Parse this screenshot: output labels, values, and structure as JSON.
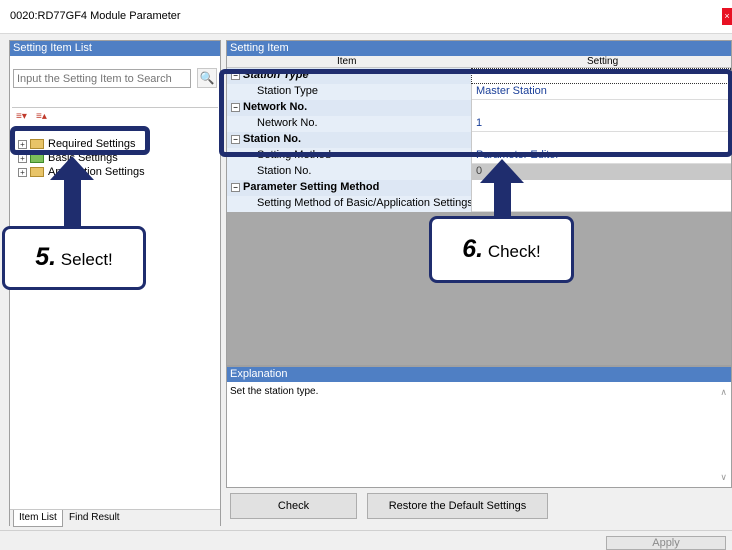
{
  "window": {
    "title": "0020:RD77GF4 Module Parameter",
    "close": "×"
  },
  "left_panel": {
    "header": "Setting Item List",
    "search_placeholder": "Input the Setting Item to Search",
    "tree_items": [
      "Required Settings",
      "Basic Settings",
      "Application Settings"
    ],
    "tabs": [
      "Item List",
      "Find Result"
    ]
  },
  "right_panel": {
    "header": "Setting Item",
    "columns": [
      "Item",
      "Setting"
    ],
    "rows": [
      {
        "item": "Station Type",
        "setting": ""
      },
      {
        "item": "Station Type",
        "setting": "Master Station"
      },
      {
        "item": "Network No.",
        "setting": ""
      },
      {
        "item": "Network No.",
        "setting": "1"
      },
      {
        "item": "Station No.",
        "setting": ""
      },
      {
        "item": "Setting Method",
        "setting": "Parameter Editor"
      },
      {
        "item": "Station No.",
        "setting": "0"
      },
      {
        "item": "Parameter Setting Method",
        "setting": ""
      },
      {
        "item": "Setting Method of Basic/Application Settings",
        "setting": ""
      }
    ]
  },
  "explanation": {
    "header": "Explanation",
    "text": "Set the station type."
  },
  "buttons": {
    "check": "Check",
    "restore": "Restore the Default Settings",
    "apply": "Apply"
  },
  "annotations": {
    "step5_number": "5.",
    "step5_text": "Select!",
    "step6_number": "6.",
    "step6_text": "Check!"
  },
  "colors": {
    "accent": "#4f7fc4",
    "annotation": "#1f2d6e",
    "setting_text": "#1a3f99"
  }
}
